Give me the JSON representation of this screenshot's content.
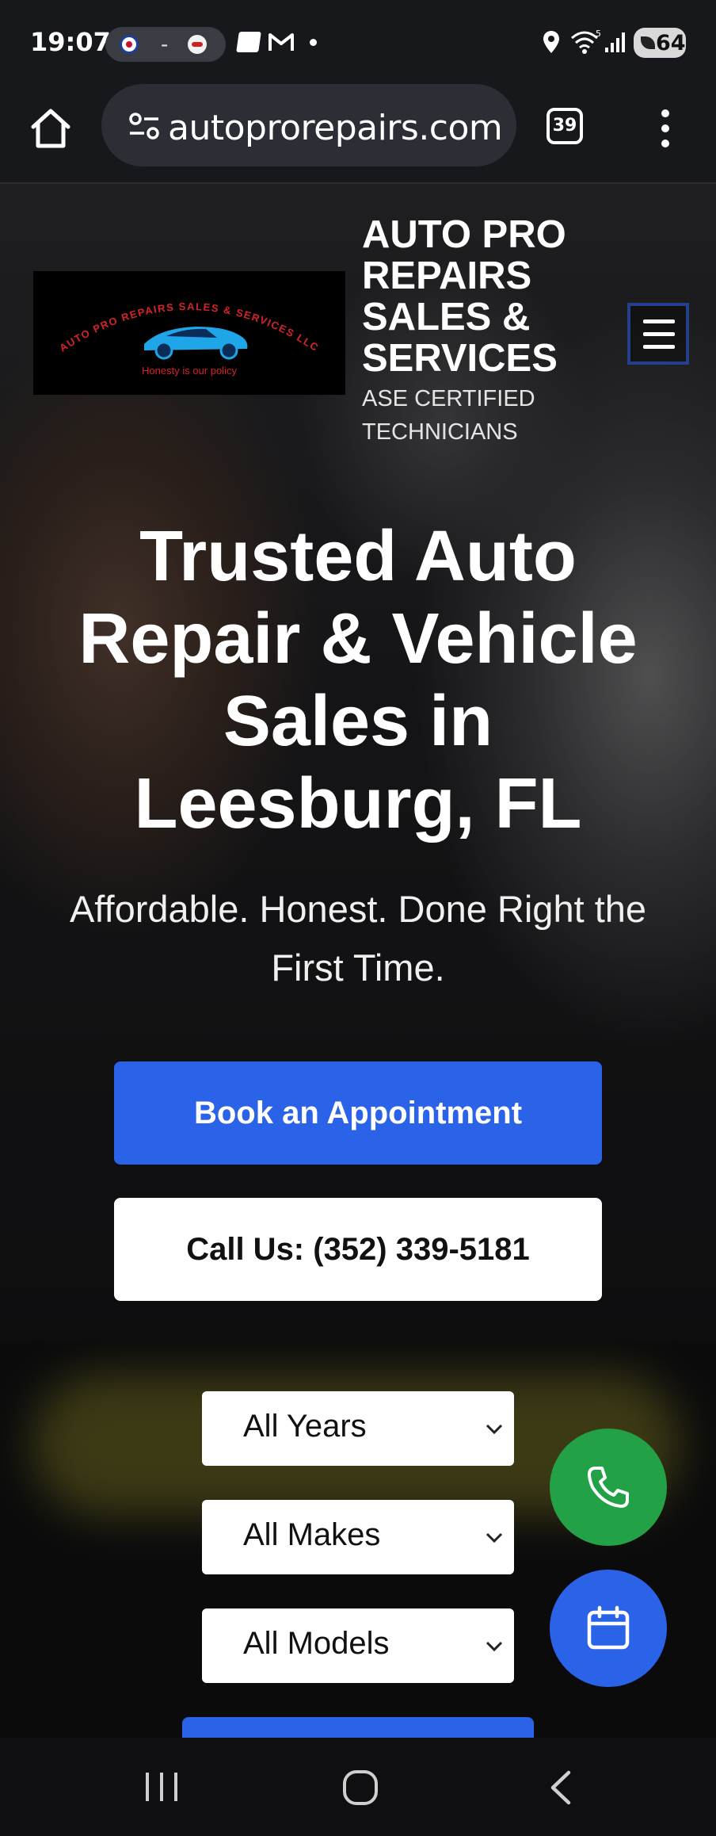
{
  "status_bar": {
    "time": "19:07",
    "separator": "-",
    "battery": "64",
    "wifi_label": "5"
  },
  "browser": {
    "url": "autoprorepairs.com",
    "tab_count": "39"
  },
  "site": {
    "logo_arc_text": "AUTO PRO REPAIRS SALES & SERVICES LLC",
    "logo_tagline": "Honesty is our policy",
    "brand_name": "AUTO PRO REPAIRS SALES & SERVICES",
    "brand_tagline": "ASE CERTIFIED TECHNICIANS"
  },
  "hero": {
    "title": "Trusted Auto Repair & Vehicle Sales in Leesburg, FL",
    "subtitle": "Affordable. Honest. Done Right the First Time.",
    "book_button": "Book an Appointment",
    "call_button": "Call Us: (352) 339-5181"
  },
  "vehicle_search": {
    "year_select": "All Years",
    "make_select": "All Makes",
    "model_select": "All Models"
  },
  "colors": {
    "primary_blue": "#2b63e8",
    "phone_green": "#23a146",
    "nav_dark": "#17181c"
  },
  "icons": [
    "home-icon",
    "site-info-icon",
    "tabs-icon",
    "more-menu-icon",
    "hamburger-icon",
    "phone-icon",
    "calendar-icon",
    "recents-icon",
    "home-nav-icon",
    "back-icon"
  ]
}
